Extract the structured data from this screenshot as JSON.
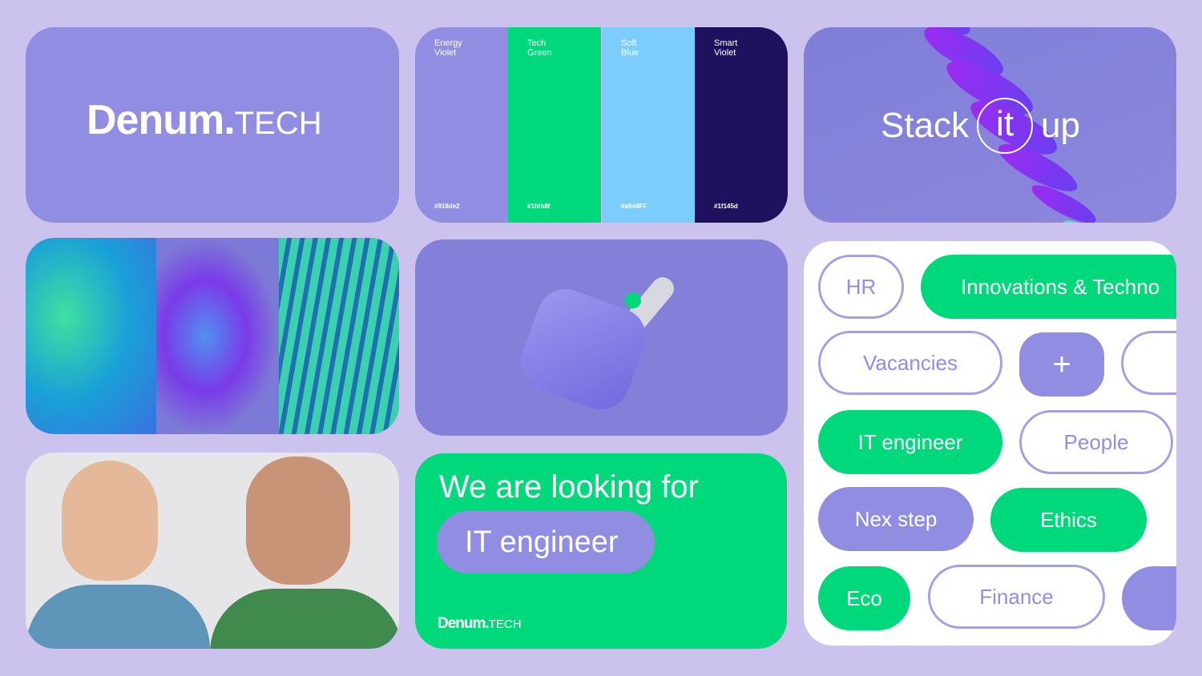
{
  "logo": {
    "bold": "Denum.",
    "light": "TECH"
  },
  "palette": [
    {
      "name1": "Energy",
      "name2": "Violet",
      "code": "#918de2",
      "color": "#918de2"
    },
    {
      "name1": "Tech",
      "name2": "Green",
      "code": "#1fdb8f",
      "color": "#00d87c"
    },
    {
      "name1": "Soft",
      "name2": "Blue",
      "code": "#a9d4FF",
      "color": "#7bcdfd"
    },
    {
      "name1": "Smart",
      "name2": "Violet",
      "code": "#1f145d",
      "color": "#1f115d"
    }
  ],
  "slogan": {
    "w1": "Stack",
    "w2": "it",
    "w3": "up"
  },
  "hiring": {
    "headline": "We are looking for",
    "role": "IT engineer"
  },
  "tags": [
    "HR",
    "Innovations & Techno",
    "Vacancies",
    "+",
    "IT engineer",
    "People",
    "Nex step",
    "Ethics",
    "Eco",
    "Finance"
  ]
}
